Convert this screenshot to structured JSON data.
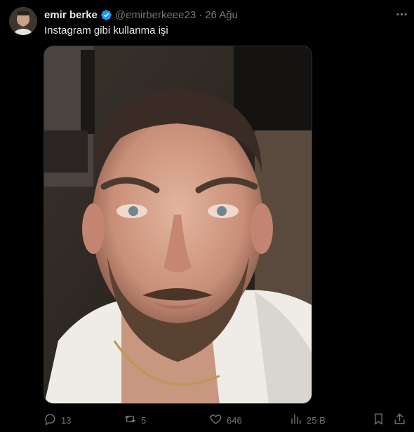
{
  "author": {
    "name": "emir berke",
    "handle": "@emirberkeee23",
    "date": "26 Ağu",
    "separator": "·"
  },
  "tweet": {
    "text": "Instagram gibi kullanma işi"
  },
  "actions": {
    "replies": "13",
    "retweets": "5",
    "likes": "646",
    "views": "25 B"
  },
  "colors": {
    "background": "#000000",
    "text": "#e7e9ea",
    "muted": "#71767b",
    "verified": "#1d9bf0"
  },
  "icons": [
    "verified-badge-icon",
    "more-icon",
    "reply-icon",
    "retweet-icon",
    "like-icon",
    "views-icon",
    "bookmark-icon",
    "share-icon"
  ]
}
